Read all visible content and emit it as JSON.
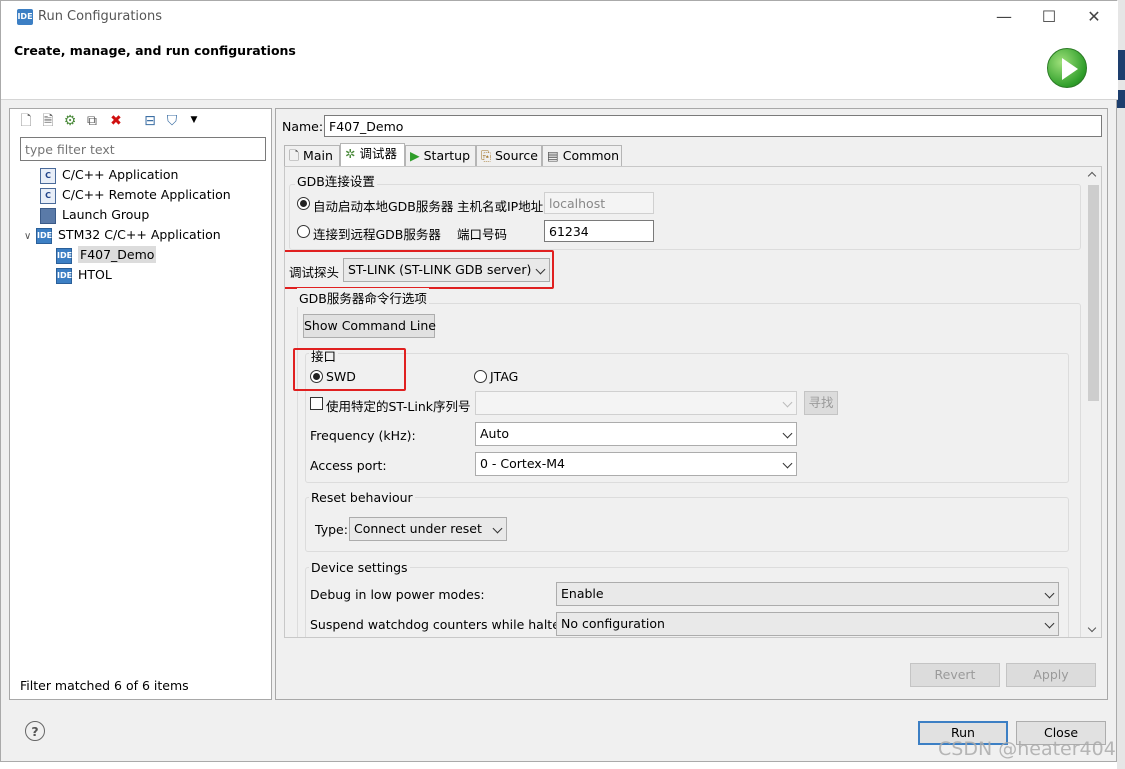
{
  "window": {
    "title": "Run Configurations",
    "app_icon": "IDE",
    "controls": {
      "minimize": "—",
      "maximize": "☐",
      "close": "✕"
    }
  },
  "header": {
    "title": "Create, manage, and run configurations",
    "icon": "run-play-icon"
  },
  "left_panel": {
    "toolbar_icons": [
      "new-config-icon",
      "new-prototype-icon",
      "export-icon",
      "duplicate-icon",
      "delete-icon",
      "collapse-all-icon",
      "filter-icon",
      "view-menu-chevron-icon"
    ],
    "filter_placeholder": "type filter text",
    "tree": [
      {
        "label": "C/C++ Application",
        "icon": "C"
      },
      {
        "label": "C/C++ Remote Application",
        "icon": "C"
      },
      {
        "label": "Launch Group",
        "icon": "launch-group-icon"
      },
      {
        "label": "STM32 C/C++ Application",
        "icon": "IDE",
        "expander": "∨"
      },
      {
        "label": "F407_Demo",
        "icon": "IDE"
      },
      {
        "label": "HTOL",
        "icon": "IDE"
      }
    ],
    "status": "Filter matched 6 of 6 items"
  },
  "config": {
    "name_label": "Name:",
    "name_value": "F407_Demo",
    "tabs": [
      {
        "label": "Main",
        "icon": "main-tab-icon"
      },
      {
        "label": "调试器",
        "icon": "debugger-bug-icon"
      },
      {
        "label": "Startup",
        "icon": "startup-play-icon"
      },
      {
        "label": "Source",
        "icon": "source-icon"
      },
      {
        "label": "Common",
        "icon": "common-icon"
      }
    ],
    "active_tab": "调试器",
    "gdb_connection": {
      "title": "GDB连接设置",
      "local_option": "自动启动本地GDB服务器",
      "host_label": "主机名或IP地址",
      "host_value": "localhost",
      "remote_option": "连接到远程GDB服务器",
      "port_label": "端口号码",
      "port_value": "61234",
      "selected": "local"
    },
    "probe": {
      "label": "调试探头",
      "value": "ST-LINK (ST-LINK GDB server)"
    },
    "gdb_server_options": {
      "title": "GDB服务器命令行选项",
      "show_cmd_button": "Show Command Line",
      "interface": {
        "title": "接口",
        "swd": "SWD",
        "jtag": "JTAG",
        "selected": "SWD"
      },
      "serial": {
        "label": "使用特定的ST-Link序列号",
        "value": "",
        "checked": false,
        "find_button": "寻找"
      },
      "frequency": {
        "label": "Frequency (kHz):",
        "value": "Auto"
      },
      "access_port": {
        "label": "Access port:",
        "value": "0 - Cortex-M4"
      }
    },
    "reset": {
      "title": "Reset behaviour",
      "type_label": "Type:",
      "type_value": "Connect under reset"
    },
    "device": {
      "title": "Device settings",
      "low_power_label": "Debug in low power modes:",
      "low_power_value": "Enable",
      "watchdog_label": "Suspend watchdog counters while halted:",
      "watchdog_value": "No configuration"
    },
    "revert_button": "Revert",
    "apply_button": "Apply"
  },
  "footer": {
    "help_icon": "?",
    "run_button": "Run",
    "close_button": "Close"
  },
  "watermark": "CSDN @heater404",
  "colors": {
    "accent": "#3c7fc4",
    "highlight_box": "#e02020",
    "selection": "#dcdcdc"
  }
}
